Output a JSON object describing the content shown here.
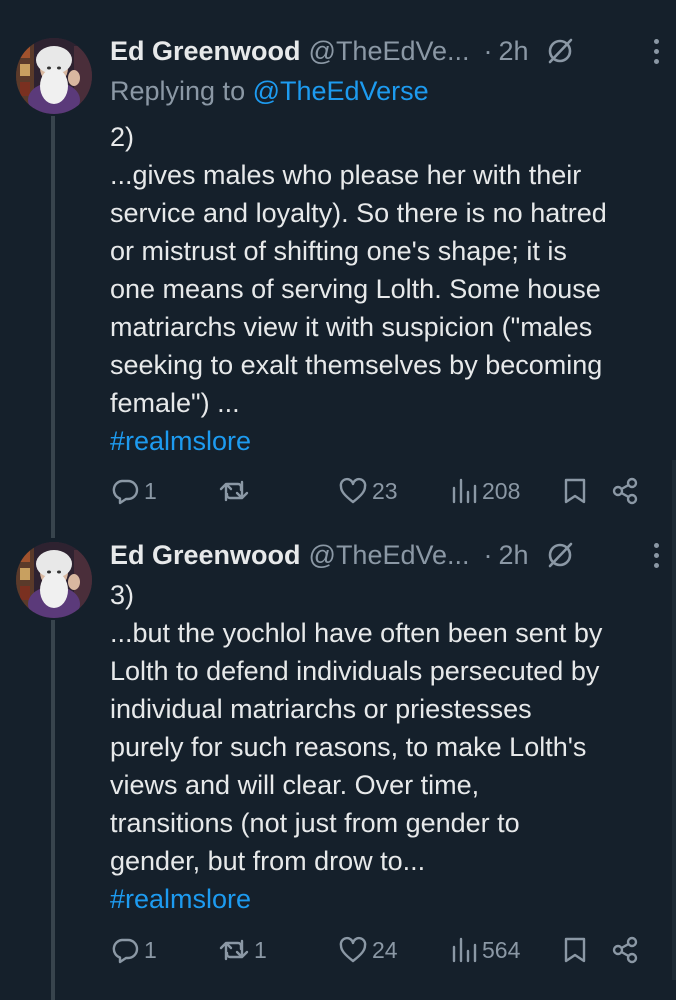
{
  "tweets": [
    {
      "author_name": "Ed Greenwood",
      "handle": "@TheEdVe...",
      "separator": "·",
      "time": "2h",
      "replying_prefix": "Replying to ",
      "replying_handle": "@TheEdVerse",
      "lines": [
        "2)",
        "...gives males who please her with their",
        "service and loyalty). So there is no hatred",
        "or mistrust of shifting one's shape; it is",
        "one means of serving Lolth. Some house",
        "matriarchs view it with suspicion (\"males",
        "seeking to exalt themselves by becoming",
        "female\") ..."
      ],
      "hashtag": "#realmslore",
      "reply_count": "1",
      "retweet_count": "",
      "like_count": "23",
      "view_count": "208"
    },
    {
      "author_name": "Ed Greenwood",
      "handle": "@TheEdVe...",
      "separator": "·",
      "time": "2h",
      "lines": [
        "3)",
        "...but the yochlol have often been sent by",
        "Lolth to defend individuals persecuted by",
        "individual matriarchs or priestesses",
        "purely for such reasons, to make Lolth's",
        "views and will clear. Over time,",
        "transitions (not just from gender to",
        "gender, but from drow to..."
      ],
      "hashtag": "#realmslore",
      "reply_count": "1",
      "retweet_count": "1",
      "like_count": "24",
      "view_count": "564"
    }
  ],
  "icons": {
    "reply": "reply-icon",
    "retweet": "retweet-icon",
    "like": "heart-icon",
    "views": "analytics-icon",
    "bookmark": "bookmark-icon",
    "share": "share-icon",
    "grok": "grok-icon",
    "more": "more-icon"
  },
  "colors": {
    "background": "#15202b",
    "text": "#e7e9ea",
    "muted": "#8b98a5",
    "accent": "#1d9bf0",
    "thread_line": "#38444d"
  }
}
